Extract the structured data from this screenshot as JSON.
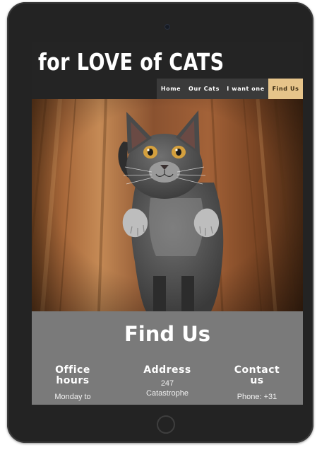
{
  "site": {
    "title": "for LOVE of CATS",
    "nav": [
      {
        "label": "Home"
      },
      {
        "label": "Our Cats"
      },
      {
        "label": "I want one"
      },
      {
        "label": "Find Us",
        "active": true
      }
    ]
  },
  "hero": {
    "image": "grey-kitten-standing-on-wood-floor-photo"
  },
  "find_us": {
    "title": "Find Us",
    "office_hours": {
      "heading": "Office hours",
      "text": "Monday to"
    },
    "address": {
      "heading": "Address",
      "text": "247 Catastrophe"
    },
    "contact": {
      "heading": "Contact us",
      "text": "Phone: +31"
    }
  },
  "colors": {
    "header_bg": "#242424",
    "nav_bg": "#3a3a3a",
    "nav_active": "#e6c48a",
    "section_bg": "#7a7a7a",
    "device_frame": "#232323"
  }
}
